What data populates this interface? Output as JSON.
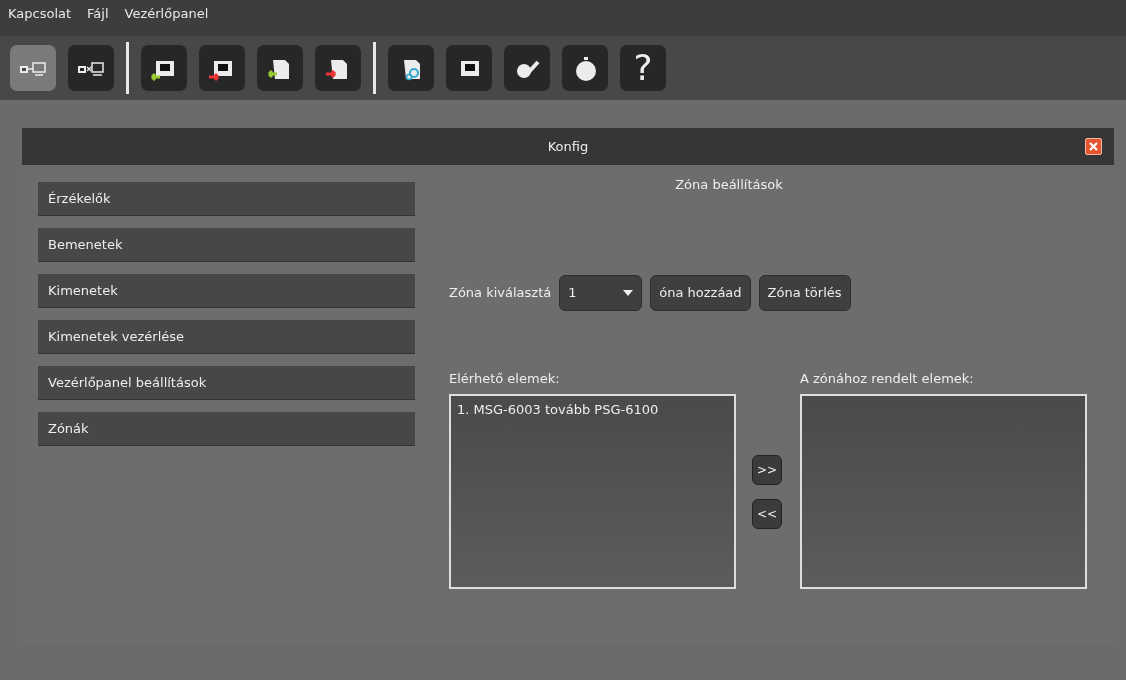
{
  "menu": [
    "Kapcsolat",
    "Fájl",
    "Vezérlőpanel"
  ],
  "toolbar": [
    {
      "kind": "connect",
      "selected": true
    },
    {
      "kind": "disconnect",
      "selected": false
    },
    {
      "kind": "separator"
    },
    {
      "kind": "panel-in",
      "selected": false
    },
    {
      "kind": "panel-out",
      "selected": false
    },
    {
      "kind": "doc-in",
      "selected": false
    },
    {
      "kind": "doc-out",
      "selected": false
    },
    {
      "kind": "separator"
    },
    {
      "kind": "doc-gear",
      "selected": false
    },
    {
      "kind": "panel",
      "selected": false
    },
    {
      "kind": "pen",
      "selected": false
    },
    {
      "kind": "timer",
      "selected": false
    },
    {
      "kind": "help",
      "label": "?",
      "selected": false
    }
  ],
  "dialog": {
    "title": "Konfig"
  },
  "sidebar": {
    "items": [
      {
        "label": "Érzékelők"
      },
      {
        "label": "Bemenetek"
      },
      {
        "label": "Kimenetek"
      },
      {
        "label": "Kimenetek vezérlése"
      },
      {
        "label": "Vezérlőpanel beállítások"
      },
      {
        "label": "Zónák"
      }
    ]
  },
  "content": {
    "title": "Zóna beállítások",
    "zone_label": "Zóna kiválasztá",
    "zone_select": {
      "value": "1"
    },
    "buttons": [
      "óna hozzáad",
      "Zóna törlés"
    ],
    "available": {
      "label": "Elérhető elemek:",
      "items": [
        "1. MSG-6003 tovább PSG-6100"
      ]
    },
    "move_buttons": [
      ">>",
      "<<"
    ],
    "assigned": {
      "label": "A zónához rendelt elemek:"
    }
  }
}
